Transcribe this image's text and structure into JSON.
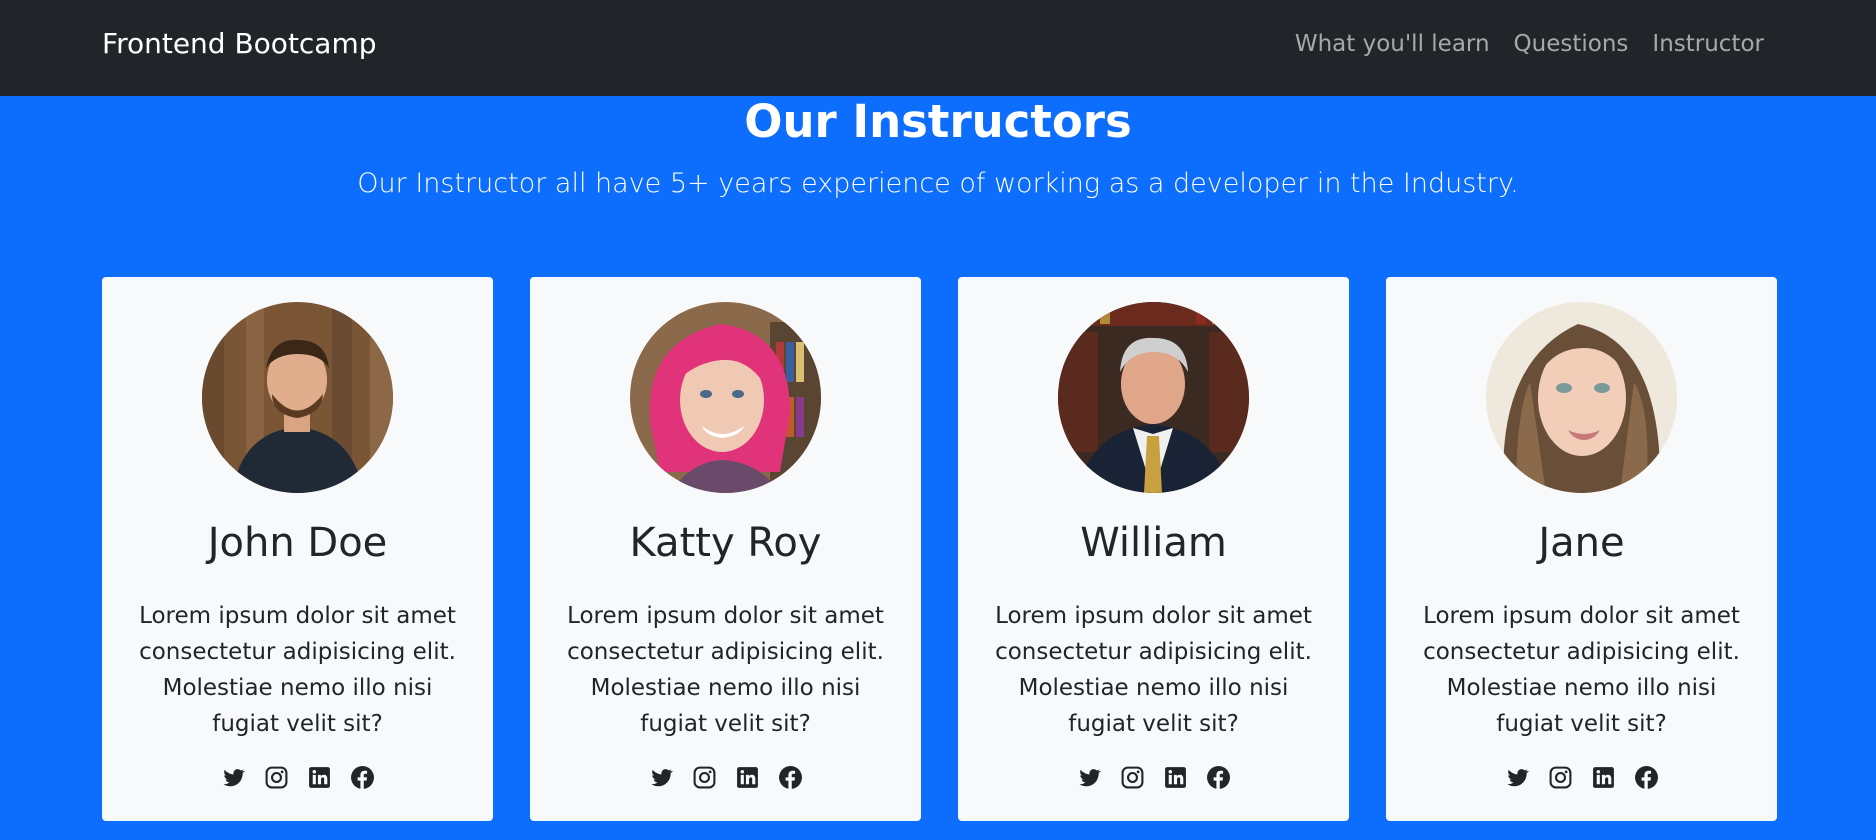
{
  "navbar": {
    "brand": "Frontend Bootcamp",
    "links": [
      "What you'll learn",
      "Questions",
      "Instructor"
    ],
    "background": "#212529"
  },
  "section": {
    "title": "Our Instructors",
    "lead": "Our Instructor all have 5+ years experience of working as a developer in the Industry.",
    "background": "#0d6efd"
  },
  "instructors": [
    {
      "name": "John Doe",
      "text": "Lorem ipsum dolor sit amet consectetur adipisicing elit. Molestiae nemo illo nisi fugiat velit sit?",
      "socials": [
        "twitter-icon",
        "instagram-icon",
        "linkedin-icon",
        "facebook-icon"
      ]
    },
    {
      "name": "Katty Roy",
      "text": "Lorem ipsum dolor sit amet consectetur adipisicing elit. Molestiae nemo illo nisi fugiat velit sit?",
      "socials": [
        "twitter-icon",
        "instagram-icon",
        "linkedin-icon",
        "facebook-icon"
      ]
    },
    {
      "name": "William",
      "text": "Lorem ipsum dolor sit amet consectetur adipisicing elit. Molestiae nemo illo nisi fugiat velit sit?",
      "socials": [
        "twitter-icon",
        "instagram-icon",
        "linkedin-icon",
        "facebook-icon"
      ]
    },
    {
      "name": "Jane",
      "text": "Lorem ipsum dolor sit amet consectetur adipisicing elit. Molestiae nemo illo nisi fugiat velit sit?",
      "socials": [
        "twitter-icon",
        "instagram-icon",
        "linkedin-icon",
        "facebook-icon"
      ]
    }
  ]
}
